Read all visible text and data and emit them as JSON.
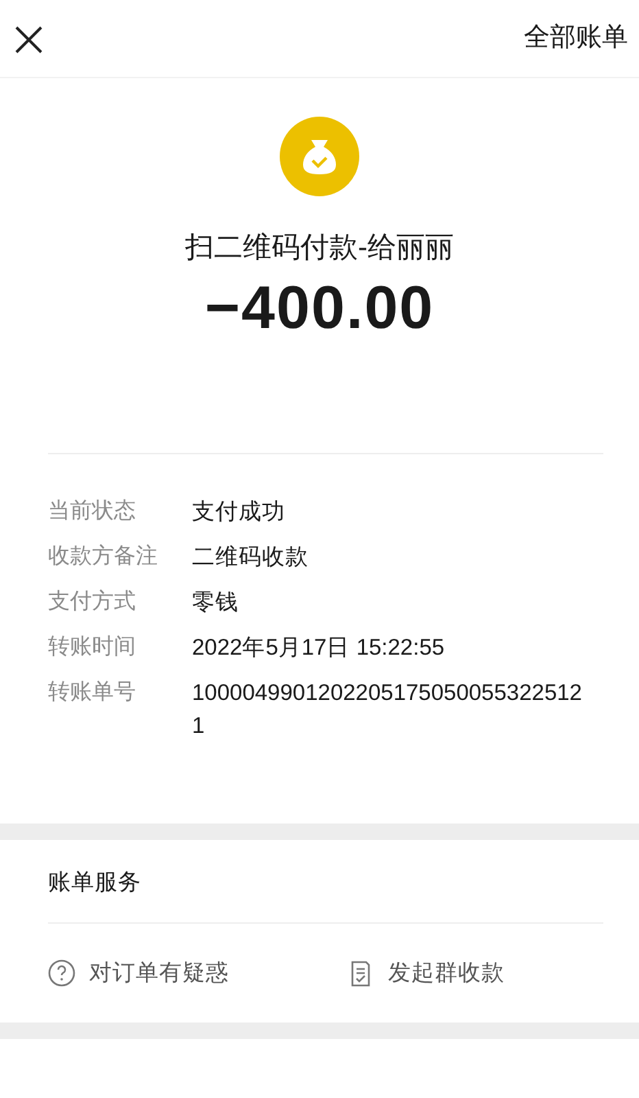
{
  "header": {
    "all_bills": "全部账单"
  },
  "payment": {
    "title": "扫二维码付款-给丽丽",
    "amount": "−400.00"
  },
  "details": [
    {
      "label": "当前状态",
      "value": "支付成功"
    },
    {
      "label": "收款方备注",
      "value": "二维码收款"
    },
    {
      "label": "支付方式",
      "value": "零钱"
    },
    {
      "label": "转账时间",
      "value": "2022年5月17日 15:22:55"
    },
    {
      "label": "转账单号",
      "value": "10000499012022051750500553225121"
    }
  ],
  "services": {
    "title": "账单服务",
    "actions": [
      {
        "kind": "question",
        "label": "对订单有疑惑"
      },
      {
        "kind": "receipt",
        "label": "发起群收款"
      }
    ]
  }
}
